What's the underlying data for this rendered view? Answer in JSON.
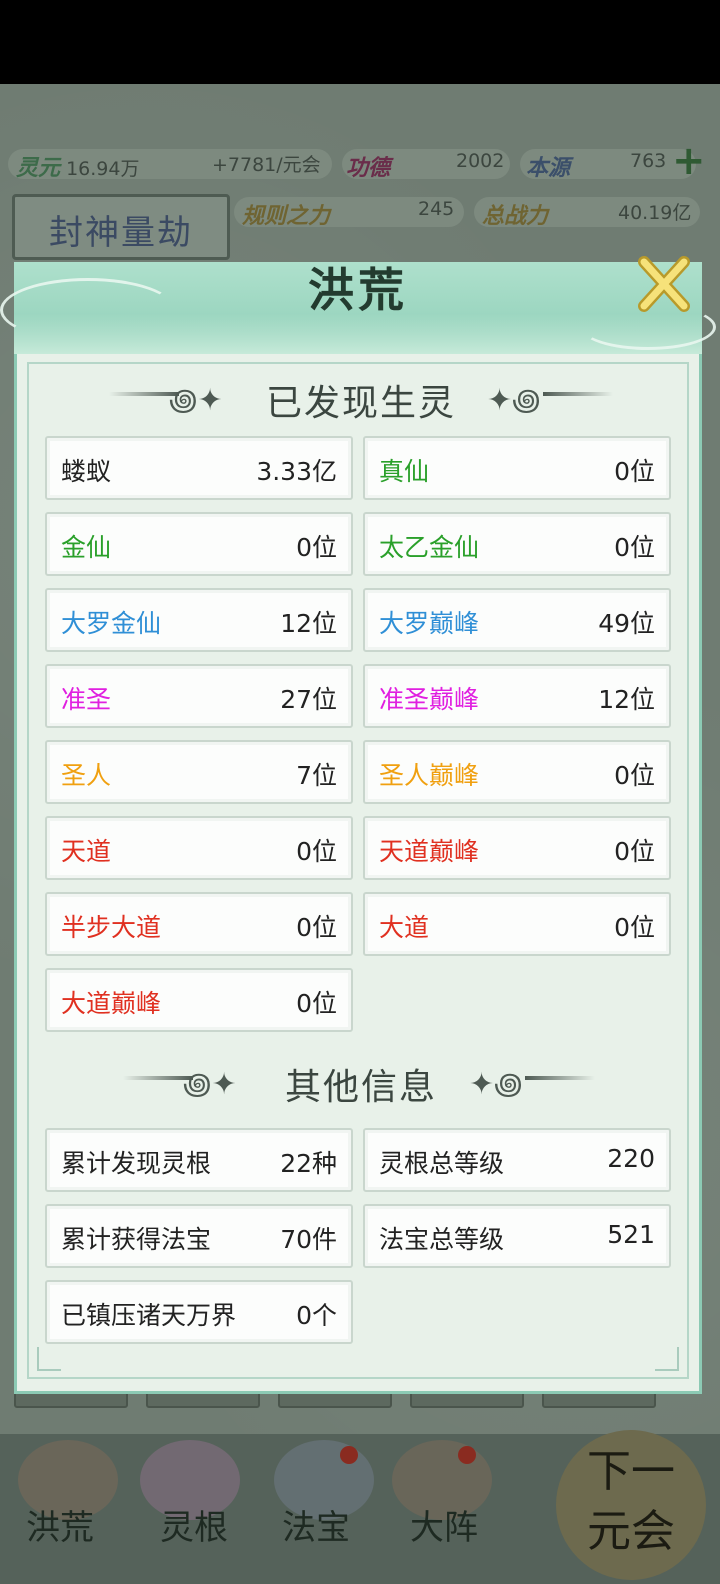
{
  "header_resources": {
    "row1": [
      {
        "key": "灵元",
        "value": "16.94万"
      },
      {
        "key": "",
        "value": "+7781/元会"
      },
      {
        "key": "功德",
        "value": "2002"
      },
      {
        "key": "本源",
        "value": "763"
      }
    ],
    "row2": [
      {
        "key": "规则之力",
        "value": "245"
      },
      {
        "key": "总战力",
        "value": "40.19亿"
      }
    ],
    "event_title": "封神量劫",
    "plus_icon": "plus-icon"
  },
  "modal": {
    "title": "洪荒",
    "close_icon": "close-x-icon",
    "section1_title": "已发现生灵",
    "beings": [
      {
        "label": "蝼蚁",
        "value": "3.33亿",
        "color": "#222222"
      },
      {
        "label": "真仙",
        "value": "0位",
        "color": "#2aa02a"
      },
      {
        "label": "金仙",
        "value": "0位",
        "color": "#2aa02a"
      },
      {
        "label": "太乙金仙",
        "value": "0位",
        "color": "#2aa02a"
      },
      {
        "label": "大罗金仙",
        "value": "12位",
        "color": "#2f8fd6"
      },
      {
        "label": "大罗巅峰",
        "value": "49位",
        "color": "#2f8fd6"
      },
      {
        "label": "准圣",
        "value": "27位",
        "color": "#e020e0"
      },
      {
        "label": "准圣巅峰",
        "value": "12位",
        "color": "#e020e0"
      },
      {
        "label": "圣人",
        "value": "7位",
        "color": "#f0a010"
      },
      {
        "label": "圣人巅峰",
        "value": "0位",
        "color": "#f0a010"
      },
      {
        "label": "天道",
        "value": "0位",
        "color": "#e03020"
      },
      {
        "label": "天道巅峰",
        "value": "0位",
        "color": "#e03020"
      },
      {
        "label": "半步大道",
        "value": "0位",
        "color": "#e03020"
      },
      {
        "label": "大道",
        "value": "0位",
        "color": "#e03020"
      },
      {
        "label": "大道巅峰",
        "value": "0位",
        "color": "#e03020"
      }
    ],
    "section2_title": "其他信息",
    "other_info": [
      {
        "label": "累计发现灵根",
        "value": "22种"
      },
      {
        "label": "灵根总等级",
        "value": "220"
      },
      {
        "label": "累计获得法宝",
        "value": "70件"
      },
      {
        "label": "法宝总等级",
        "value": "521"
      },
      {
        "label": "已镇压诸天万界",
        "value": "0个"
      }
    ]
  },
  "bottom_nav": {
    "items": [
      {
        "label": "洪荒",
        "icon": "mountain-icon"
      },
      {
        "label": "灵根",
        "icon": "lotus-icon"
      },
      {
        "label": "法宝",
        "icon": "treasure-icon"
      },
      {
        "label": "大阵",
        "icon": "formation-icon"
      }
    ],
    "next_button_line1": "下一",
    "next_button_line2": "元会"
  }
}
